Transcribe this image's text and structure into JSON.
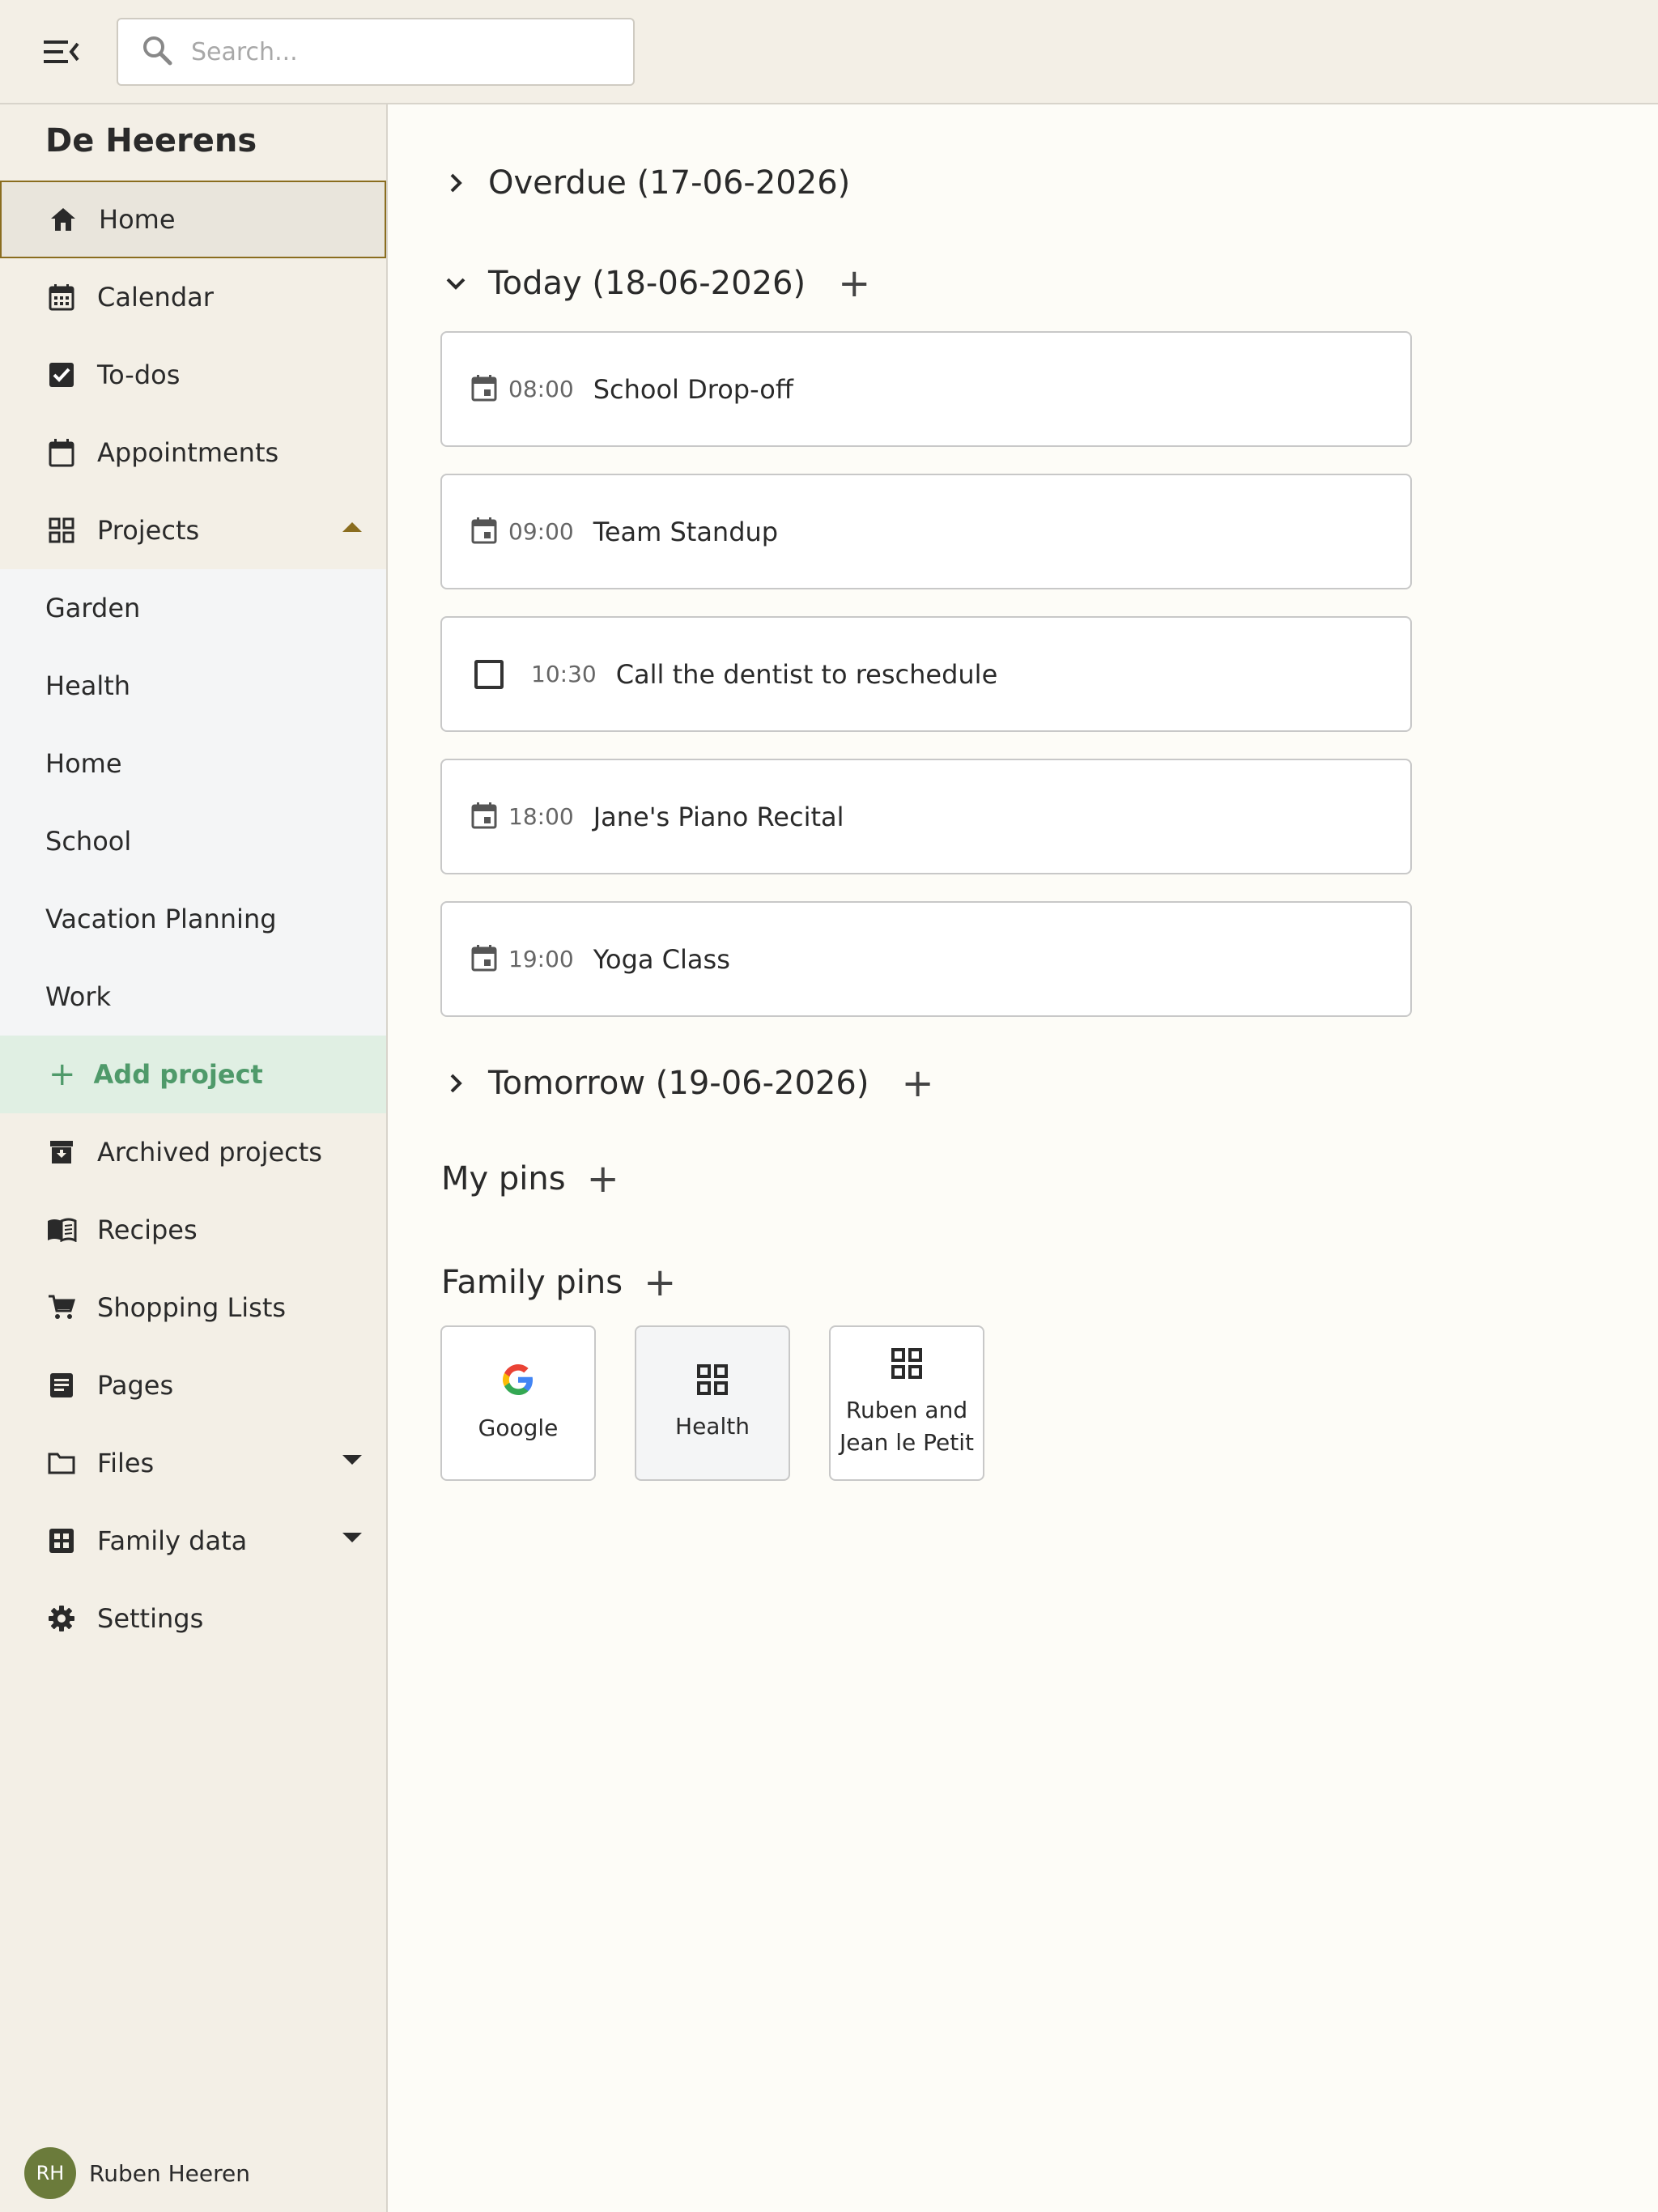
{
  "topbar": {
    "menu_icon": "menu-collapse-icon",
    "search_placeholder": "Search..."
  },
  "sidebar": {
    "family_name": "De Heerens",
    "items": [
      {
        "label": "Home",
        "icon": "home-icon"
      },
      {
        "label": "Calendar",
        "icon": "calendar-icon"
      },
      {
        "label": "To-dos",
        "icon": "checkbox-icon"
      },
      {
        "label": "Appointments",
        "icon": "calendar-blank-icon"
      },
      {
        "label": "Projects",
        "icon": "grid-icon"
      }
    ],
    "projects": [
      "Garden",
      "Health",
      "Home",
      "School",
      "Vacation Planning",
      "Work"
    ],
    "add_project": "Add project",
    "items_after": [
      {
        "label": "Archived projects",
        "icon": "archive-icon"
      },
      {
        "label": "Recipes",
        "icon": "book-icon"
      },
      {
        "label": "Shopping Lists",
        "icon": "cart-icon"
      },
      {
        "label": "Pages",
        "icon": "page-icon"
      },
      {
        "label": "Files",
        "icon": "folder-icon"
      },
      {
        "label": "Family data",
        "icon": "table-icon"
      },
      {
        "label": "Settings",
        "icon": "gear-icon"
      }
    ],
    "user": {
      "initials": "RH",
      "name": "Ruben Heeren"
    }
  },
  "main": {
    "overdue": "Overdue (17-06-2026)",
    "today": "Today (18-06-2026)",
    "events": [
      {
        "time": "08:00",
        "title": "School Drop-off",
        "kind": "event"
      },
      {
        "time": "09:00",
        "title": "Team Standup",
        "kind": "event"
      },
      {
        "time": "10:30",
        "title": "Call the dentist to reschedule",
        "kind": "todo"
      },
      {
        "time": "18:00",
        "title": "Jane's Piano Recital",
        "kind": "event"
      },
      {
        "time": "19:00",
        "title": "Yoga Class",
        "kind": "event"
      }
    ],
    "tomorrow": "Tomorrow (19-06-2026)",
    "my_pins": "My pins",
    "family_pins": "Family pins",
    "pins": [
      {
        "label": "Google",
        "icon": "google-icon"
      },
      {
        "label": "Health",
        "icon": "grid-icon"
      },
      {
        "label_line1": "Ruben and",
        "label_line2": "Jean le Petit",
        "icon": "grid-icon"
      }
    ]
  },
  "colors": {
    "accent_gold": "#8a6d1f",
    "add_green": "#4f9a6a",
    "avatar_olive": "#6b7b3b"
  }
}
